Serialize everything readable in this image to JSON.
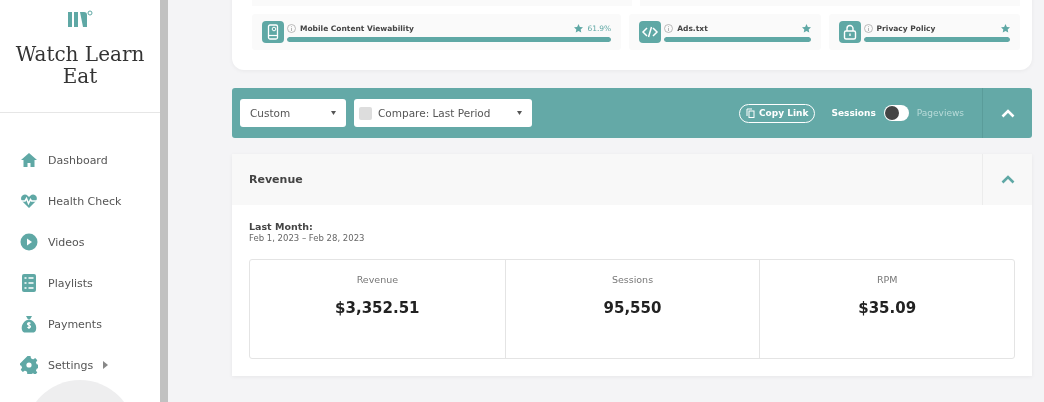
{
  "sidebar": {
    "brand": "Watch Learn Eat",
    "items": [
      {
        "kind": "home",
        "label": "Dashboard",
        "has_submenu": false
      },
      {
        "kind": "heart",
        "label": "Health Check",
        "has_submenu": false
      },
      {
        "kind": "play",
        "label": "Videos",
        "has_submenu": false
      },
      {
        "kind": "list",
        "label": "Playlists",
        "has_submenu": false
      },
      {
        "kind": "money",
        "label": "Payments",
        "has_submenu": false
      },
      {
        "kind": "gear",
        "label": "Settings",
        "has_submenu": true
      }
    ]
  },
  "health": [
    {
      "kind": "mobile",
      "label": "Mobile Content Viewability",
      "value": "61.9%",
      "level": 1
    },
    {
      "kind": "code",
      "label": "Ads.txt",
      "level": 1
    },
    {
      "kind": "lock",
      "label": "Privacy Policy",
      "level": 1
    }
  ],
  "toolbar": {
    "range": "Custom",
    "compare": {
      "label": "Compare: Last Period",
      "checked": false
    },
    "copy_link": "Copy Link",
    "metric_options": [
      {
        "label": "Sessions",
        "selected": true
      },
      {
        "label": "Pageviews",
        "selected": false
      }
    ]
  },
  "revenue": {
    "title": "Revenue",
    "expanded": true,
    "period_label": "Last Month:",
    "period_dates": "Feb 1, 2023 – Feb 28, 2023",
    "stats": [
      {
        "label": "Revenue",
        "value": "$3,352.51"
      },
      {
        "label": "Sessions",
        "value": "95,550"
      },
      {
        "label": "RPM",
        "value": "$35.09"
      }
    ]
  }
}
